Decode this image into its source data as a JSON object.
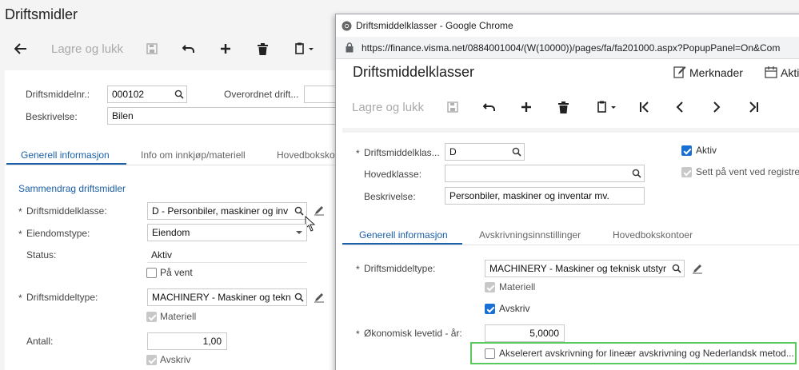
{
  "background": {
    "title": "Driftsmidler",
    "toolbar": {
      "save_close": "Lagre og lukk"
    },
    "fields": {
      "asset_no_label": "Driftsmiddelnr.:",
      "asset_no_value": "000102",
      "parent_label": "Overordnet drift...",
      "description_label": "Beskrivelse:",
      "description_value": "Bilen"
    },
    "tabs": [
      "Generell informasjon",
      "Info om innkjøp/materiell",
      "Hovedboksko"
    ],
    "section_title": "Sammendrag driftsmidler",
    "summary": {
      "class_label": "Driftsmiddelklasse:",
      "class_value": "D - Personbiler, maskiner og inv",
      "property_label": "Eiendomstype:",
      "property_value": "Eiendom",
      "status_label": "Status:",
      "status_value": "Aktiv",
      "on_hold_label": "På vent",
      "type_label": "Driftsmiddeltype:",
      "type_value": "MACHINERY - Maskiner og tekn",
      "material_label": "Materiell",
      "count_label": "Antall:",
      "count_value": "1,00",
      "depreciate_label": "Avskriv"
    },
    "required_mark": "*"
  },
  "popup": {
    "window_title": "Driftsmiddelklasser - Google Chrome",
    "url": "https://finance.visma.net/0884001004/(W(10000))/pages/fa/fa201000.aspx?PopupPanel=On&Com",
    "page_title": "Driftsmiddelklasser",
    "notes_label": "Merknader",
    "activities_label": "Akti",
    "toolbar": {
      "save_close": "Lagre og lukk"
    },
    "fields": {
      "class_label": "Driftsmiddelklas...",
      "class_value": "D",
      "main_class_label": "Hovedklasse:",
      "main_class_value": "",
      "description_label": "Beskrivelse:",
      "description_value": "Personbiler, maskiner og inventar mv.",
      "active_label": "Aktiv",
      "hold_label": "Sett på vent ved registre"
    },
    "tabs": [
      "Generell informasjon",
      "Avskrivningsinnstillinger",
      "Hovedbokskontoer"
    ],
    "general": {
      "type_label": "Driftsmiddeltype:",
      "type_value": "MACHINERY - Maskiner og teknisk utstyr",
      "material_label": "Materiell",
      "depreciate_label": "Avskriv",
      "lifetime_label": "Økonomisk levetid - år:",
      "lifetime_value": "5,0000",
      "accelerated_label": "Akselerert avskrivning for lineær avskrivning og Nederlandsk metod..."
    },
    "required_mark": "*"
  },
  "colors": {
    "accent": "#1a5fa8",
    "highlight_box": "#5cc95c",
    "checkbox_checked": "#1a6fd4"
  }
}
